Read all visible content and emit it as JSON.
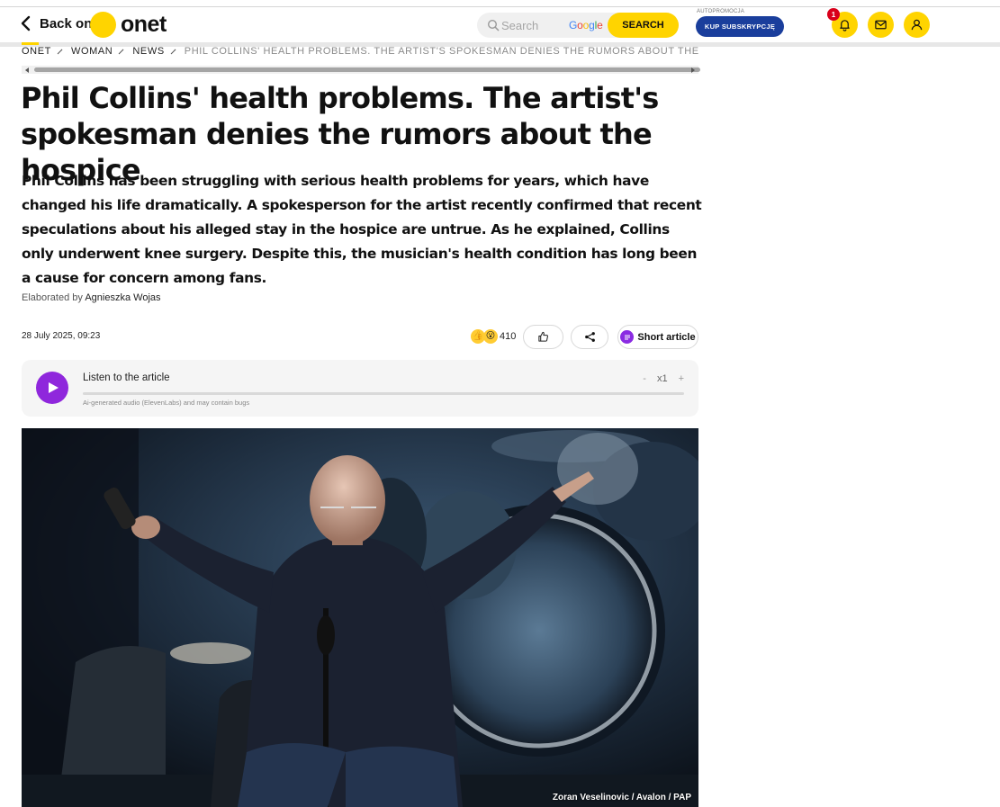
{
  "header": {
    "back_label": "Back on",
    "logo_text": "onet",
    "search": {
      "placeholder": "Search",
      "provider": "Google",
      "button_label": "SEARCH"
    },
    "promo_label": "AUTOPROMOCJA",
    "subscribe_label": "KUP SUBSKRYPCJĘ",
    "notification_count": "1",
    "icons": [
      "bell-icon",
      "mail-icon",
      "user-icon"
    ],
    "accent_color": "#ffd400"
  },
  "breadcrumb": [
    "ONET",
    "WOMAN",
    "NEWS",
    "PHIL COLLINS' HEALTH PROBLEMS. THE ARTIST'S SPOKESMAN DENIES THE RUMORS ABOUT THE HOSPICE"
  ],
  "article": {
    "title": "Phil Collins' health problems. The artist's spokesman denies the rumors about the hospice",
    "lead": "Phil Collins has been struggling with serious health problems for years, which have changed his life dramatically. A spokesperson for the artist recently confirmed that recent speculations about his alleged stay in the hospice are untrue. As he explained, Collins only underwent knee surgery. Despite this, the musician's health condition has long been a cause for concern among fans.",
    "author_prefix": "Elaborated by",
    "author": "Agnieszka Wojas",
    "date": "28 July 2025, 09:23",
    "reaction_count": "410",
    "short_article_label": "Short article"
  },
  "player": {
    "title": "Listen to the article",
    "disclaimer": "Ai-generated audio (ElevenLabs) and may contain bugs",
    "minus": "-",
    "speed": "x1",
    "plus": "+",
    "progress": 0,
    "accent_color": "#8f27dc"
  },
  "photo": {
    "credit": "Zoran Veselinovic / Avalon / PAP"
  }
}
